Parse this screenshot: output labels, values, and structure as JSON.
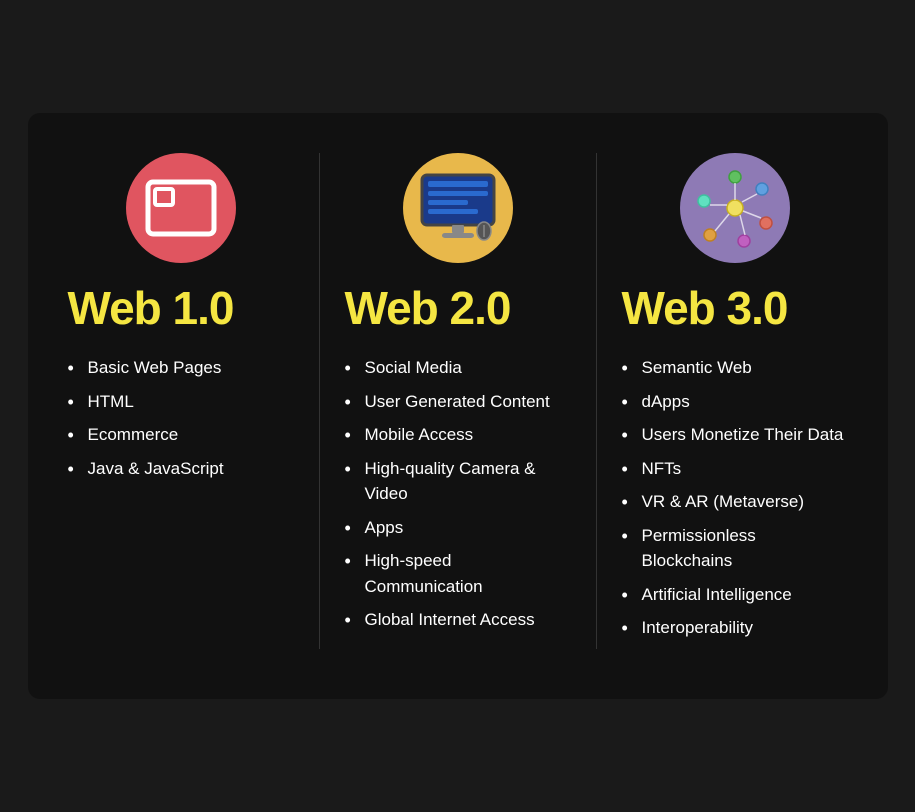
{
  "columns": [
    {
      "id": "web1",
      "icon_type": "browser",
      "icon_color": "red",
      "title": "Web 1.0",
      "items": [
        "Basic Web Pages",
        "HTML",
        "Ecommerce",
        "Java & JavaScript"
      ]
    },
    {
      "id": "web2",
      "icon_type": "monitor",
      "icon_color": "yellow",
      "title": "Web 2.0",
      "items": [
        "Social Media",
        "User Generated Content",
        "Mobile Access",
        "High-quality Camera & Video",
        "Apps",
        "High-speed Communication",
        "Global Internet Access"
      ]
    },
    {
      "id": "web3",
      "icon_type": "network",
      "icon_color": "purple",
      "title": "Web 3.0",
      "items": [
        "Semantic Web",
        "dApps",
        "Users Monetize Their Data",
        "NFTs",
        "VR & AR (Metaverse)",
        "Permissionless Blockchains",
        "Artificial Intelligence",
        "Interoperability"
      ]
    }
  ]
}
